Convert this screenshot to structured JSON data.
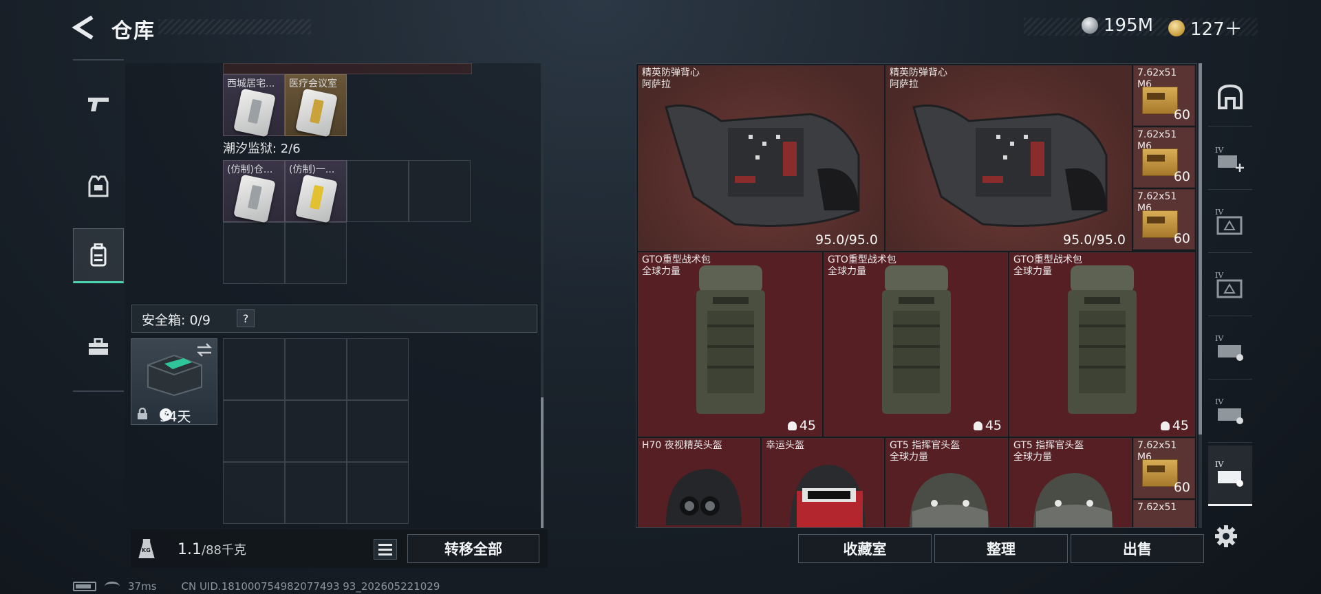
{
  "header": {
    "title": "仓库",
    "back_icon": "back-arrow-icon"
  },
  "currency": {
    "silver": "195M",
    "gold": "127＋",
    "silver_icon": "silver-coin-icon",
    "gold_icon": "gold-coin-icon"
  },
  "left_nav": [
    {
      "name": "weapons",
      "icon": "pistol-icon",
      "active": false
    },
    {
      "name": "equipment",
      "icon": "armor-vest-icon",
      "active": false
    },
    {
      "name": "backpack",
      "icon": "backpack-icon",
      "active": true
    },
    {
      "name": "toolbox",
      "icon": "toolbox-icon",
      "active": false
    }
  ],
  "container": {
    "top_cards": [
      {
        "label": "西城居宅...",
        "color": "purple"
      },
      {
        "label": "医疗会议室",
        "color": "brown"
      }
    ],
    "section_label": "潮汐监狱: 2/6",
    "cards": [
      {
        "label": "(仿制)仓...",
        "stripe": "grey"
      },
      {
        "label": "(仿制)一...",
        "stripe": "yellow"
      }
    ],
    "safe_label": "安全箱: 0/9",
    "help": "?",
    "safe_timer": "34天",
    "swap_icon": "swap-icon",
    "lock_icon": "lock-icon",
    "clock_icon": "clock-icon"
  },
  "weight": {
    "current": "1.1",
    "max": "/88千克",
    "icon": "weight-kg-icon"
  },
  "transfer_all": "转移全部",
  "list_icon": "list-icon",
  "stash": {
    "armor": [
      {
        "name": "精英防弹背心",
        "brand": "阿萨拉",
        "durability": "95.0/95.0"
      },
      {
        "name": "精英防弹背心",
        "brand": "阿萨拉",
        "durability": "95.0/95.0"
      }
    ],
    "ammo": [
      {
        "name": "7.62x51",
        "sub": "M6",
        "count": "60"
      },
      {
        "name": "7.62x51",
        "sub": "M6",
        "count": "60"
      },
      {
        "name": "7.62x51",
        "sub": "M6",
        "count": "60"
      },
      {
        "name": "7.62x51",
        "sub": "M6",
        "count": "60"
      },
      {
        "name": "7.62x51",
        "sub": ""
      }
    ],
    "bags": [
      {
        "name": "GTO重型战术包",
        "brand": "全球力量",
        "capacity": "45"
      },
      {
        "name": "GTO重型战术包",
        "brand": "全球力量",
        "capacity": "45"
      },
      {
        "name": "GTO重型战术包",
        "brand": "全球力量",
        "capacity": "45"
      }
    ],
    "helmets": [
      {
        "name": "H70 夜视精英头盔",
        "brand": ""
      },
      {
        "name": "幸运头盔",
        "brand": ""
      },
      {
        "name": "GT5 指挥官头盔",
        "brand": "全球力量"
      },
      {
        "name": "GT5 指挥官头盔",
        "brand": "全球力量"
      }
    ]
  },
  "bottom_buttons": {
    "collection": "收藏室",
    "sort": "整理",
    "sell": "出售"
  },
  "right_sidebar": [
    {
      "icon": "stash-all-icon"
    },
    {
      "icon": "add-stash-icon",
      "tier": "IV"
    },
    {
      "icon": "stash-tab-icon",
      "tier": "IV"
    },
    {
      "icon": "stash-tab-icon",
      "tier": "IV"
    },
    {
      "icon": "stash-tab-icon",
      "tier": "IV"
    },
    {
      "icon": "stash-tab-icon",
      "tier": "IV"
    },
    {
      "icon": "stash-tab-icon",
      "tier": "IV",
      "active": true
    }
  ],
  "settings_icon": "gear-icon",
  "status": {
    "ping": "37ms",
    "uid": "CN UID.181000754982077493 93_202605221029"
  }
}
